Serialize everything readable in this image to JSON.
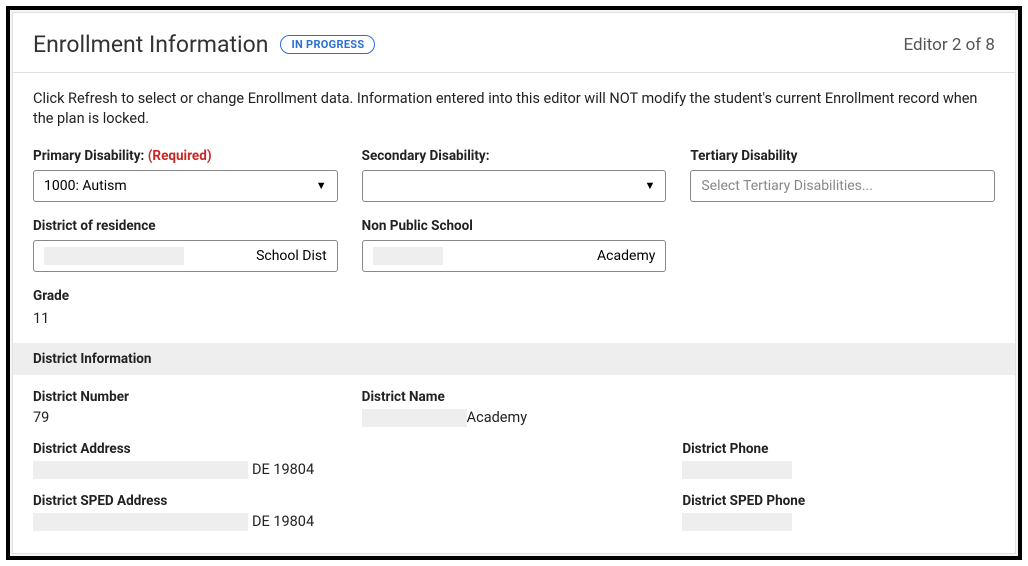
{
  "header": {
    "title": "Enrollment Information",
    "badge": "IN PROGRESS",
    "editor_count": "Editor 2 of 8"
  },
  "intro": "Click Refresh to select or change Enrollment data. Information entered into this editor will NOT modify the student's current Enrollment record when the plan is locked.",
  "fields": {
    "primary_disability": {
      "label": "Primary Disability:",
      "required": "(Required)",
      "value": "1000: Autism"
    },
    "secondary_disability": {
      "label": "Secondary Disability:",
      "value": ""
    },
    "tertiary_disability": {
      "label": "Tertiary Disability",
      "placeholder": "Select Tertiary Disabilities..."
    },
    "district_residence": {
      "label": "District of residence",
      "suffix": "School Dist"
    },
    "non_public_school": {
      "label": "Non Public School",
      "suffix": "Academy"
    },
    "grade": {
      "label": "Grade",
      "value": "11"
    }
  },
  "district_section": {
    "header": "District Information",
    "number": {
      "label": "District Number",
      "value": "79"
    },
    "name": {
      "label": "District Name",
      "suffix": "Academy"
    },
    "address": {
      "label": "District Address",
      "suffix": "DE 19804"
    },
    "phone": {
      "label": "District Phone"
    },
    "sped_address": {
      "label": "District SPED Address",
      "suffix": "DE 19804"
    },
    "sped_phone": {
      "label": "District SPED Phone"
    }
  }
}
